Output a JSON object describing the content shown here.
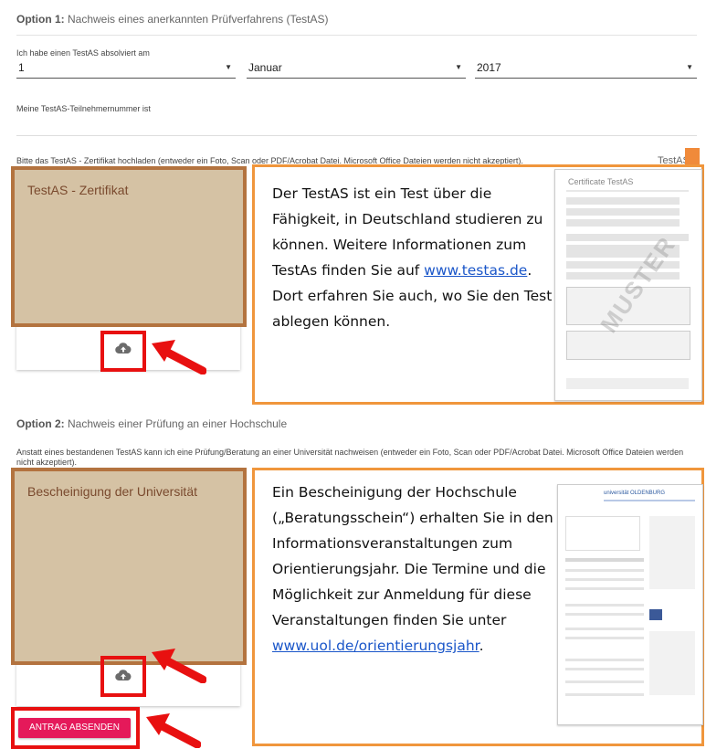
{
  "option1": {
    "title_prefix": "Option 1:",
    "title_rest": " Nachweis eines anerkannten Prüfverfahrens (TestAS)",
    "date_label": "Ich habe einen TestAS absolviert am",
    "day_value": "1",
    "month_value": "Januar",
    "year_value": "2017",
    "participant_label": "Meine TestAS-Teilnehmernummer ist",
    "upload_instruction": "Bitte das TestAS - Zertifikat hochladen (entweder ein Foto, Scan oder PDF/Acrobat Datei. Microsoft Office Dateien werden nicht akzeptiert).",
    "preview_label": "TestAS - Zertifikat",
    "callout_line1": "Der TestAS ist ein Test über die Fähigkeit, in Deutschland studieren zu können. Weitere Informationen zum TestAs finden Sie auf ",
    "callout_link": "www.testas.de",
    "callout_line2": ". Dort erfahren Sie auch, wo Sie den Test ablegen können.",
    "doc_title": "Certificate TestAS",
    "doc_logo": "TestAS",
    "doc_watermark": "MUSTER"
  },
  "option2": {
    "title_prefix": "Option 2:",
    "title_rest": " Nachweis einer Prüfung an einer Hochschule",
    "upload_instruction": "Anstatt eines bestandenen TestAS kann ich eine Prüfung/Beratung an einer Universität nachweisen (entweder ein Foto, Scan oder PDF/Acrobat Datei. Microsoft Office Dateien werden nicht akzeptiert).",
    "preview_label": "Bescheinigung der Universität",
    "callout_line1": "Ein Bescheinigung der Hochschule („Beratungsschein“) erhalten Sie in den Informationsveranstaltungen zum Orientierungsjahr. Die Termine und die Möglichkeit zur Anmeldung für diese Veranstaltungen finden Sie unter ",
    "callout_link": "www.uol.de/orientierungsjahr",
    "callout_line2": ".",
    "doc_header": "universität OLDENBURG"
  },
  "submit_label": "ANTRAG ABSENDEN",
  "icons": {
    "upload": "cloud-upload-icon",
    "arrow": "red-arrow-icon",
    "dropdown": "caret-down-icon"
  },
  "colors": {
    "accent": "#e5195a",
    "highlight_red": "#e81010",
    "callout_orange": "#f0963c",
    "preview_fill": "#d5c2a4",
    "preview_border": "#b3733f"
  }
}
